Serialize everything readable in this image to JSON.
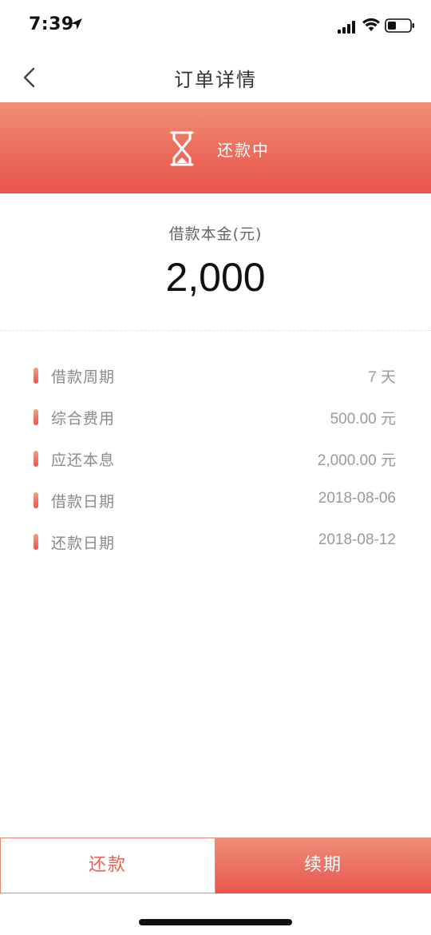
{
  "status_bar": {
    "time": "7:39",
    "icons": [
      "location-arrow-icon",
      "signal-icon",
      "wifi-icon",
      "battery-icon"
    ]
  },
  "nav": {
    "back_icon": "chevron-left-icon",
    "title": "订单详情"
  },
  "banner": {
    "icon": "hourglass-icon",
    "status": "还款中",
    "colors": {
      "top": "#ee8f76",
      "bottom": "#e8554d"
    }
  },
  "principal": {
    "label": "借款本金(元)",
    "amount": "2,000"
  },
  "details": [
    {
      "label": "借款周期",
      "value": "7 天"
    },
    {
      "label": "综合费用",
      "value": "500.00 元"
    },
    {
      "label": "应还本息",
      "value": "2,000.00 元"
    },
    {
      "label": "借款日期",
      "value": "2018-08-06"
    },
    {
      "label": "还款日期",
      "value": "2018-08-12"
    }
  ],
  "actions": {
    "repay_label": "还款",
    "renew_label": "续期",
    "accent_color": "#e8604f"
  }
}
